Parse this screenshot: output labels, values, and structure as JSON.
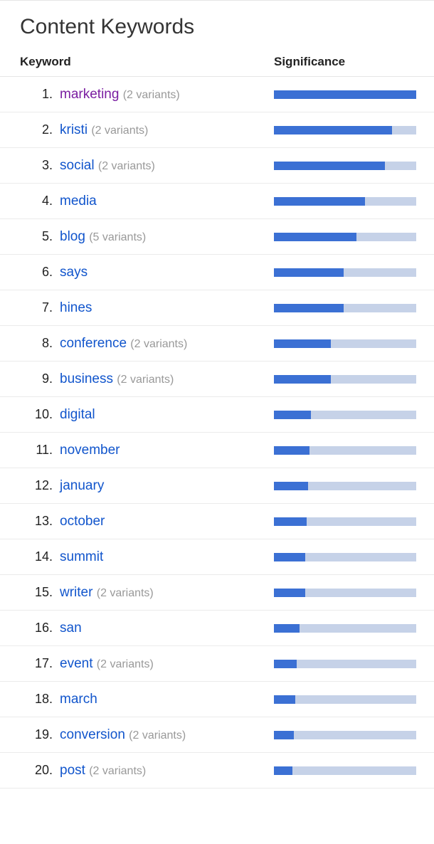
{
  "title": "Content Keywords",
  "headers": {
    "keyword": "Keyword",
    "significance": "Significance"
  },
  "colors": {
    "barFill": "#3b70d4",
    "barTrack": "#c6d2e8",
    "link": "#1155cc",
    "visited": "#7a1ea1"
  },
  "chart_data": {
    "type": "bar",
    "title": "Content Keywords",
    "xlabel": "Significance",
    "ylabel": "Keyword",
    "ylim": [
      0,
      100
    ],
    "categories": [
      "marketing",
      "kristi",
      "social",
      "media",
      "blog",
      "says",
      "hines",
      "conference",
      "business",
      "digital",
      "november",
      "january",
      "october",
      "summit",
      "writer",
      "san",
      "event",
      "march",
      "conversion",
      "post"
    ],
    "values": [
      100,
      83,
      78,
      64,
      58,
      49,
      49,
      40,
      40,
      26,
      25,
      24,
      23,
      22,
      22,
      18,
      16,
      15,
      14,
      13
    ]
  },
  "rows": [
    {
      "rank": "1.",
      "keyword": "marketing",
      "variants": "(2 variants)",
      "significance": 100,
      "visited": true
    },
    {
      "rank": "2.",
      "keyword": "kristi",
      "variants": "(2 variants)",
      "significance": 83,
      "visited": false
    },
    {
      "rank": "3.",
      "keyword": "social",
      "variants": "(2 variants)",
      "significance": 78,
      "visited": false
    },
    {
      "rank": "4.",
      "keyword": "media",
      "variants": "",
      "significance": 64,
      "visited": false
    },
    {
      "rank": "5.",
      "keyword": "blog",
      "variants": "(5 variants)",
      "significance": 58,
      "visited": false
    },
    {
      "rank": "6.",
      "keyword": "says",
      "variants": "",
      "significance": 49,
      "visited": false
    },
    {
      "rank": "7.",
      "keyword": "hines",
      "variants": "",
      "significance": 49,
      "visited": false
    },
    {
      "rank": "8.",
      "keyword": "conference",
      "variants": "(2 variants)",
      "significance": 40,
      "visited": false
    },
    {
      "rank": "9.",
      "keyword": "business",
      "variants": "(2 variants)",
      "significance": 40,
      "visited": false
    },
    {
      "rank": "10.",
      "keyword": "digital",
      "variants": "",
      "significance": 26,
      "visited": false
    },
    {
      "rank": "11.",
      "keyword": "november",
      "variants": "",
      "significance": 25,
      "visited": false
    },
    {
      "rank": "12.",
      "keyword": "january",
      "variants": "",
      "significance": 24,
      "visited": false
    },
    {
      "rank": "13.",
      "keyword": "october",
      "variants": "",
      "significance": 23,
      "visited": false
    },
    {
      "rank": "14.",
      "keyword": "summit",
      "variants": "",
      "significance": 22,
      "visited": false
    },
    {
      "rank": "15.",
      "keyword": "writer",
      "variants": "(2 variants)",
      "significance": 22,
      "visited": false
    },
    {
      "rank": "16.",
      "keyword": "san",
      "variants": "",
      "significance": 18,
      "visited": false
    },
    {
      "rank": "17.",
      "keyword": "event",
      "variants": "(2 variants)",
      "significance": 16,
      "visited": false
    },
    {
      "rank": "18.",
      "keyword": "march",
      "variants": "",
      "significance": 15,
      "visited": false
    },
    {
      "rank": "19.",
      "keyword": "conversion",
      "variants": "(2 variants)",
      "significance": 14,
      "visited": false
    },
    {
      "rank": "20.",
      "keyword": "post",
      "variants": "(2 variants)",
      "significance": 13,
      "visited": false
    }
  ]
}
